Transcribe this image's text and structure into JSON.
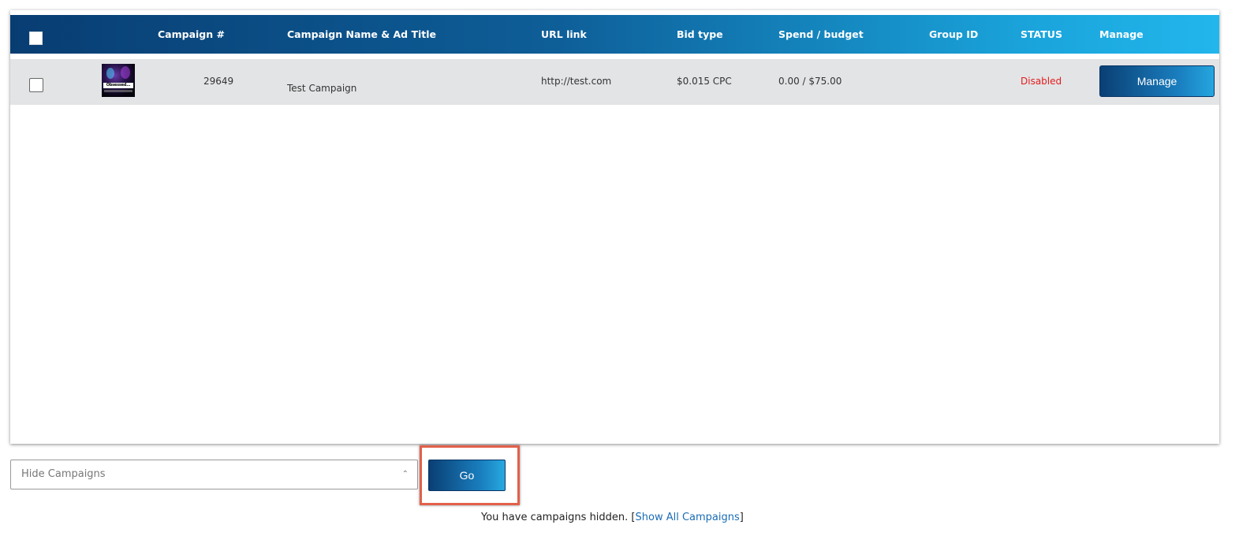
{
  "table": {
    "headers": {
      "campaign_num": "Campaign #",
      "name_title": "Campaign Name & Ad Title",
      "url": "URL link",
      "bid_type": "Bid type",
      "spend_budget": "Spend / budget",
      "group_id": "Group ID",
      "status": "STATUS",
      "manage": "Manage"
    },
    "rows": [
      {
        "thumbnail_text": "Obsessed...",
        "campaign_num": "29649",
        "name": "Test Campaign",
        "url": "http://test.com",
        "bid_type": "$0.015 CPC",
        "spend_budget": "0.00 / $75.00",
        "group_id": "",
        "status": "Disabled",
        "manage_label": "Manage"
      }
    ]
  },
  "controls": {
    "hide_select_placeholder": "Hide Campaigns",
    "go_label": "Go"
  },
  "notice": {
    "text": "You have campaigns hidden. [",
    "link": "Show All Campaigns",
    "suffix": "]"
  },
  "colors": {
    "header_start": "#083d72",
    "header_end": "#22b6ec",
    "status_disabled": "#e31b1b",
    "link": "#1a6cb5",
    "highlight": "#e2604a"
  }
}
